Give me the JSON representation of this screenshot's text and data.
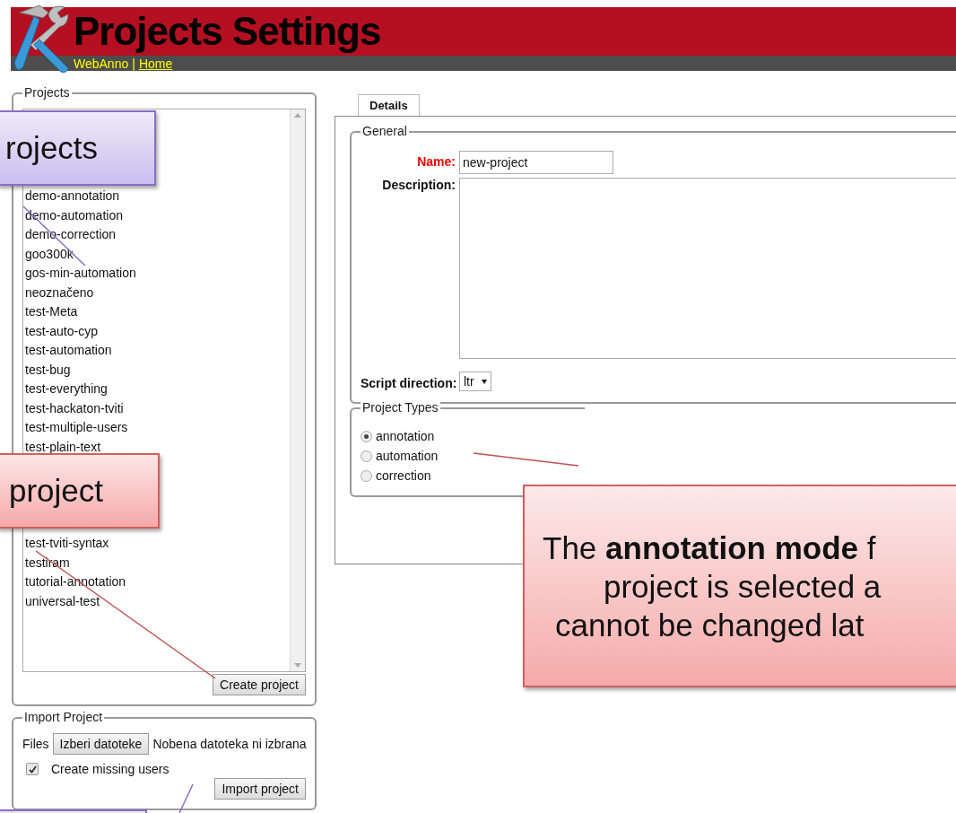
{
  "header": {
    "title": "Projects Settings",
    "breadcrumb": {
      "app": "WebAnno",
      "separator": "|",
      "home_link": "Home"
    }
  },
  "projects_panel": {
    "legend": "Projects",
    "list_groups": [
      [
        "demo-annotation",
        "demo-automation",
        "demo-correction",
        "goo300k",
        "gos-min-automation",
        "neoznačeno",
        "test-Meta",
        "test-auto-cyp",
        "test-automation",
        "test-bug",
        "test-everything",
        "test-hackaton-tviti",
        "test-multiple-users",
        "test-plain-text"
      ],
      [
        "test-tviti-syntax",
        "testiram",
        "tutorial-annotation",
        "universal-test"
      ]
    ],
    "create_button": "Create project"
  },
  "import_panel": {
    "legend": "Import Project",
    "files_label": "Files",
    "file_button": "Izberi datoteke",
    "file_status": "Nobena datoteka ni izbrana",
    "create_users": {
      "label": "Create missing users",
      "checked": true
    },
    "import_button": "Import project"
  },
  "details": {
    "tabs": [
      {
        "label": "Details",
        "selected": true
      }
    ],
    "general": {
      "legend": "General",
      "name_label": "Name:",
      "name_value": "new-project",
      "description_label": "Description:",
      "script_label": "Script direction:",
      "script_value": "ltr"
    },
    "project_types": {
      "legend": "Project Types",
      "options": [
        {
          "label": "annotation",
          "selected": true
        },
        {
          "label": "automation",
          "selected": false
        },
        {
          "label": "correction",
          "selected": false
        }
      ]
    }
  },
  "callouts": [
    {
      "kind": "purple",
      "text": "rojects"
    },
    {
      "kind": "red",
      "text": "project"
    },
    {
      "kind": "red-large",
      "lines": [
        "The **annotation mode** f",
        "project is selected a",
        "cannot be changed lat"
      ]
    },
    {
      "kind": "purple-bottom"
    }
  ]
}
